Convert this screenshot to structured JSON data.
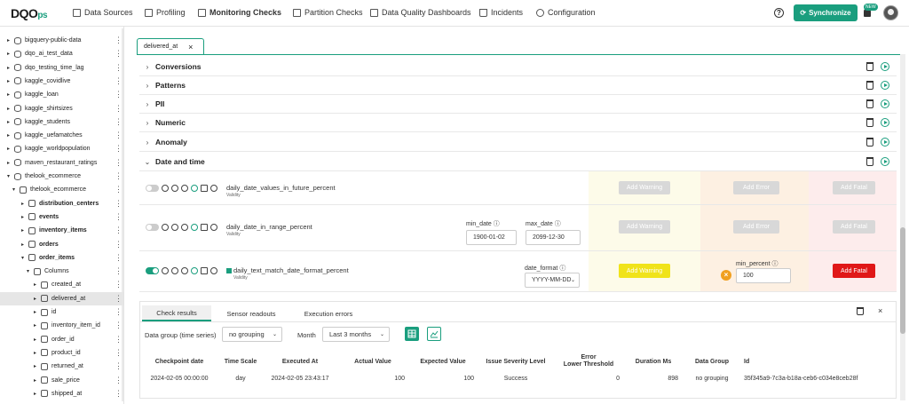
{
  "app": {
    "logo_main": "DQO",
    "logo_sup": "ps",
    "nav": [
      {
        "label": "Data Sources",
        "icon": "database-icon"
      },
      {
        "label": "Profiling",
        "icon": "file-icon"
      },
      {
        "label": "Monitoring Checks",
        "icon": "calendar-icon",
        "active": true
      },
      {
        "label": "Partition Checks",
        "icon": "calendar-icon"
      },
      {
        "label": "Data Quality Dashboards",
        "icon": "dashboard-icon"
      },
      {
        "label": "Incidents",
        "icon": "warning-icon"
      },
      {
        "label": "Configuration",
        "icon": "gear-icon"
      }
    ],
    "help": "?",
    "sync_label": "Synchronize",
    "new_badge": "NEW"
  },
  "sidebar": {
    "items": [
      {
        "label": "bigquery-public-data",
        "kind": "db"
      },
      {
        "label": "dqo_ai_test_data",
        "kind": "db"
      },
      {
        "label": "dqo_testing_time_lag",
        "kind": "db"
      },
      {
        "label": "kaggle_covidlive",
        "kind": "db"
      },
      {
        "label": "kaggle_loan",
        "kind": "db"
      },
      {
        "label": "kaggle_shirtsizes",
        "kind": "db"
      },
      {
        "label": "kaggle_students",
        "kind": "db"
      },
      {
        "label": "kaggle_uefamatches",
        "kind": "db"
      },
      {
        "label": "kaggle_worldpopulation",
        "kind": "db"
      },
      {
        "label": "maven_restaurant_ratings",
        "kind": "db"
      },
      {
        "label": "thelook_ecommerce",
        "kind": "db"
      },
      {
        "label": "thelook_ecommerce",
        "kind": "schema"
      },
      {
        "label": "distribution_centers",
        "kind": "table"
      },
      {
        "label": "events",
        "kind": "table"
      },
      {
        "label": "inventory_items",
        "kind": "table"
      },
      {
        "label": "orders",
        "kind": "table"
      },
      {
        "label": "order_items",
        "kind": "table"
      },
      {
        "label": "Columns",
        "kind": "folder"
      },
      {
        "label": "created_at",
        "kind": "column"
      },
      {
        "label": "delivered_at",
        "kind": "column",
        "selected": true
      },
      {
        "label": "id",
        "kind": "column"
      },
      {
        "label": "inventory_item_id",
        "kind": "column"
      },
      {
        "label": "order_id",
        "kind": "column"
      },
      {
        "label": "product_id",
        "kind": "column"
      },
      {
        "label": "returned_at",
        "kind": "column"
      },
      {
        "label": "sale_price",
        "kind": "column"
      },
      {
        "label": "shipped_at",
        "kind": "column"
      }
    ]
  },
  "tab": {
    "label": "delivered_at",
    "close": "×"
  },
  "categories": [
    {
      "label": "Conversions",
      "chev": "›"
    },
    {
      "label": "Patterns",
      "chev": "›"
    },
    {
      "label": "PII",
      "chev": "›"
    },
    {
      "label": "Numeric",
      "chev": "›"
    },
    {
      "label": "Anomaly",
      "chev": "›"
    },
    {
      "label": "Date and time",
      "chev": "⌄"
    }
  ],
  "checks": [
    {
      "name": "daily_date_values_in_future_percent",
      "sub": "Validity",
      "warning": "Add Warning",
      "error": "Add Error",
      "fatal": "Add Fatal"
    },
    {
      "name": "daily_date_in_range_percent",
      "sub": "Validity",
      "min_date_label": "min_date",
      "min_date": "1900-01-02",
      "max_date_label": "max_date",
      "max_date": "2099-12-30",
      "warning": "Add Warning",
      "error": "Add Error",
      "fatal": "Add Fatal"
    },
    {
      "name": "daily_text_match_date_format_percent",
      "sub": "Validity",
      "date_format_label": "date_format",
      "date_format": "YYYY-MM-DD",
      "warning": "Add Warning",
      "min_percent_label": "min_percent",
      "min_percent": "100",
      "fatal": "Add Fatal"
    }
  ],
  "results": {
    "tabs": [
      "Check results",
      "Sensor readouts",
      "Execution errors"
    ],
    "group_label": "Data group (time series)",
    "group_value": "no grouping",
    "month_label": "Month",
    "month_value": "Last 3 months",
    "columns": [
      "Checkpoint date",
      "Time Scale",
      "Executed At",
      "Actual Value",
      "Expected Value",
      "Issue Severity Level",
      "Error\nLower Threshold",
      "Duration Ms",
      "Data Group",
      "Id"
    ],
    "rows": [
      [
        "2024-02-05 00:00:00",
        "day",
        "2024-02-05 23:43:17",
        "100",
        "100",
        "Success",
        "0",
        "898",
        "no grouping",
        "35f345a9-7c3a-b18a-ceb6-c034e8ceb28f"
      ]
    ]
  },
  "colors": {
    "accent": "#1a9e7e",
    "warning": "#f0e31a",
    "fatal": "#e01818",
    "error_badge": "#f0a020"
  }
}
